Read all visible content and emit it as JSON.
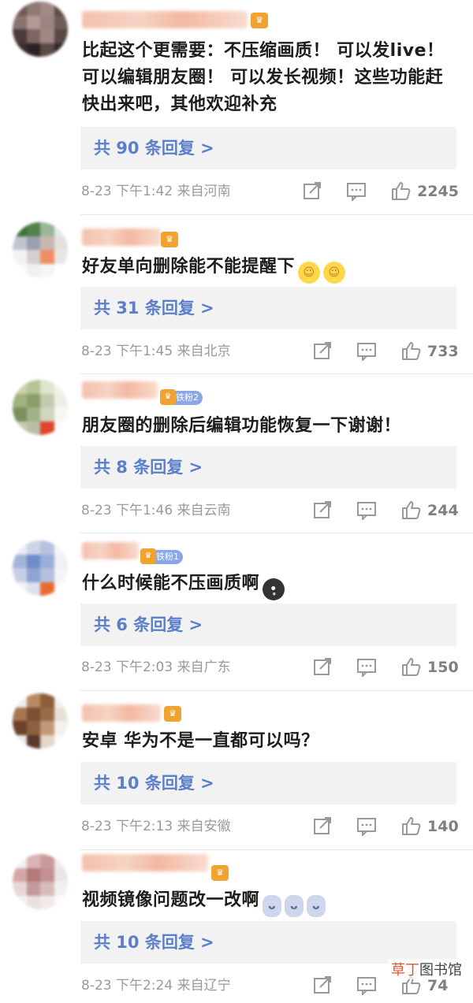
{
  "comments": [
    {
      "text": "比起这个更需要：不压缩画质！ 可以发live！ 可以编辑朋友圈！ 可以发长视频！这些功能赶快出来吧，其他欢迎补充",
      "replies": "共 90 条回复 >",
      "time": "8-23 下午1:42",
      "location": "来自河南",
      "likes": "2245"
    },
    {
      "text": "好友单向删除能不能提醒下",
      "replies": "共 31 条回复 >",
      "time": "8-23 下午1:45",
      "location": "来自北京",
      "likes": "733"
    },
    {
      "text": "朋友圈的删除后编辑功能恢复一下谢谢！",
      "badge": "铁粉2",
      "replies": "共 8 条回复 >",
      "time": "8-23 下午1:46",
      "location": "来自云南",
      "likes": "244"
    },
    {
      "text": "什么时候能不压画质啊",
      "badge": "铁粉1",
      "replies": "共 6 条回复 >",
      "time": "8-23 下午2:03",
      "location": "来自广东",
      "likes": "150"
    },
    {
      "text": "安卓 华为不是一直都可以吗？",
      "replies": "共 10 条回复 >",
      "time": "8-23 下午2:13",
      "location": "来自安徽",
      "likes": "140"
    },
    {
      "text": "视频镜像问题改一改啊",
      "replies": "共 10 条回复 >",
      "time": "8-23 下午2:24",
      "location": "来自辽宁",
      "likes": "74"
    }
  ],
  "icons": {
    "repost": "repost-icon",
    "comment": "comment-icon",
    "like": "like-icon"
  },
  "watermark": {
    "accent": "草丁",
    "rest": "图书馆"
  },
  "colors": {
    "reply_link": "#5b7fc9",
    "meta_text": "#9a9a9a",
    "reply_bg": "#f2f2f2"
  }
}
